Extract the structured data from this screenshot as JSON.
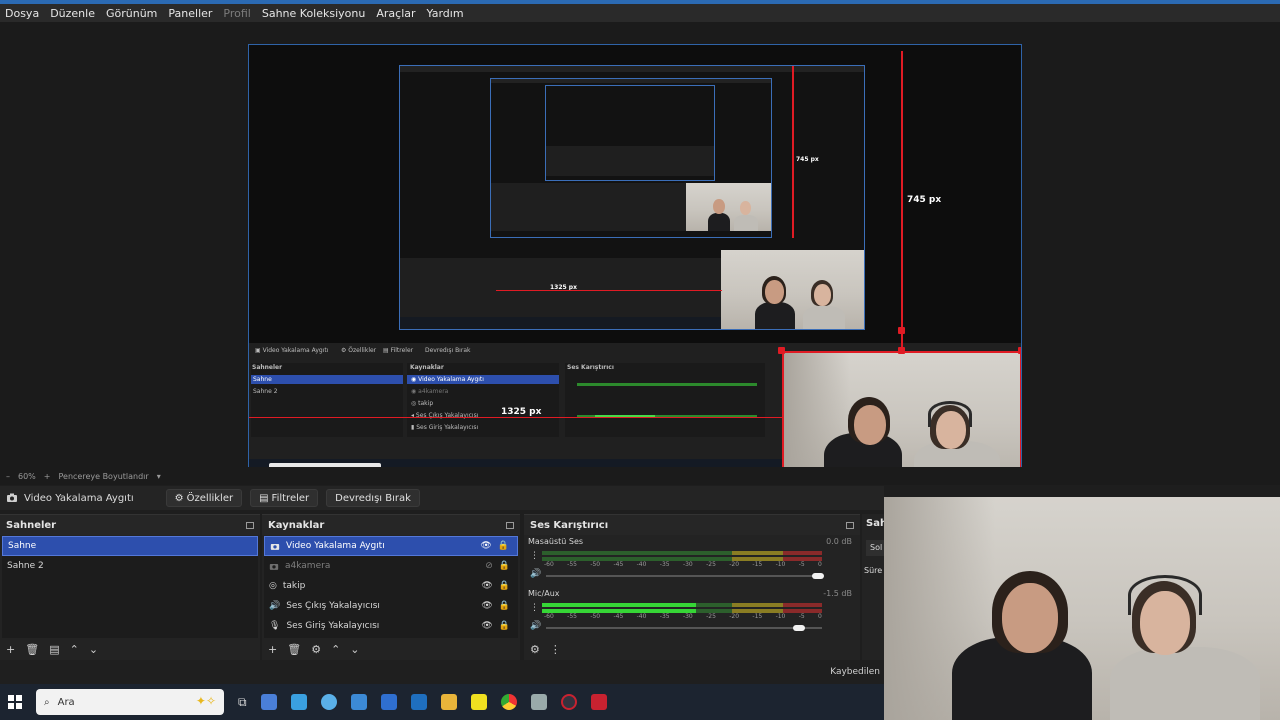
{
  "menu": {
    "items": [
      "Dosya",
      "Düzenle",
      "Görünüm",
      "Paneller",
      "Profil",
      "Sahne Koleksiyonu",
      "Araçlar",
      "Yardım"
    ],
    "disabled_index": 4
  },
  "preview": {
    "measure_vertical": "745 px",
    "measure_horizontal": "1325 px"
  },
  "zoom_row": {
    "zoom": "60%",
    "fit_label": "Pencereye Boyutlandır"
  },
  "source_toolbar": {
    "source_name": "Video Yakalama Aygıtı",
    "properties": "Özellikler",
    "filters": "Filtreler",
    "deactivate": "Devredışı Bırak"
  },
  "scenes": {
    "title": "Sahneler",
    "items": [
      "Sahne",
      "Sahne 2"
    ],
    "selected_index": 0
  },
  "sources": {
    "title": "Kaynaklar",
    "items": [
      {
        "label": "Video Yakalama Aygıtı",
        "icon": "camera-icon",
        "visible": true
      },
      {
        "label": "a4kamera",
        "icon": "camera-icon",
        "visible": false
      },
      {
        "label": "takip",
        "icon": "browser-icon",
        "visible": true
      },
      {
        "label": "Ses Çıkış Yakalayıcısı",
        "icon": "speaker-icon",
        "visible": true
      },
      {
        "label": "Ses Giriş Yakalayıcısı",
        "icon": "microphone-icon",
        "visible": true
      }
    ],
    "selected_index": 0
  },
  "mixer": {
    "title": "Ses Karıştırıcı",
    "ticks": [
      "-60",
      "-55",
      "-50",
      "-45",
      "-40",
      "-35",
      "-30",
      "-25",
      "-20",
      "-15",
      "-10",
      "-5",
      "0"
    ],
    "channels": [
      {
        "name": "Masaüstü Ses",
        "db": "0.0 dB",
        "level": 0.0,
        "volume": 1.0
      },
      {
        "name": "Mic/Aux",
        "db": "-1.5 dB",
        "level": 0.55,
        "volume": 0.93
      }
    ]
  },
  "right_dock": {
    "title": "Sah",
    "btn": "Sol",
    "label": "Süre"
  },
  "status": {
    "text": "Kaybedilen"
  },
  "taskbar": {
    "search_placeholder": "Ara"
  },
  "colors": {
    "accent": "#2d4fad",
    "red": "#e01b24",
    "meter_green": "#36d636"
  }
}
